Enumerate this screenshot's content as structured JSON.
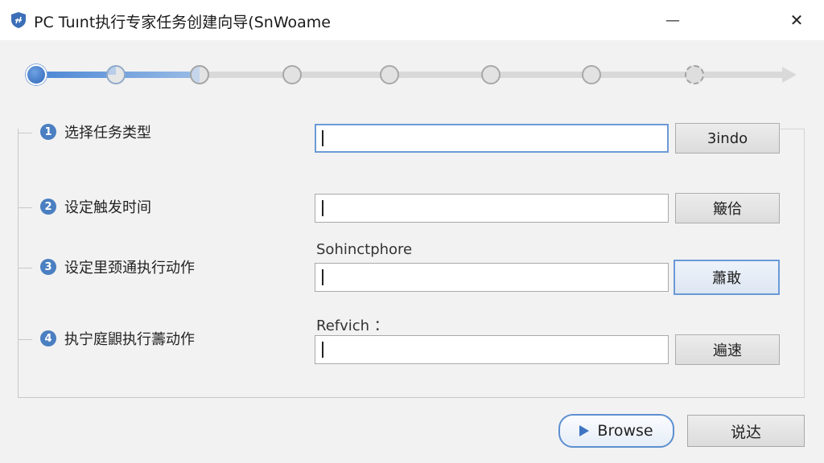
{
  "window": {
    "title": "PC Tuınt执行专家任务创建向导(SnWoame",
    "minimize_glyph": "—",
    "close_glyph": "✕",
    "icon": "app-shield-icon"
  },
  "stepper": {
    "total_steps": 8,
    "current_step": 1,
    "accent_color": "#3f7ad0"
  },
  "steps": [
    {
      "number": "1",
      "label": "选择任务类型",
      "caption": "",
      "button": "3indo",
      "input_value": ""
    },
    {
      "number": "2",
      "label": "设定触发时间",
      "caption": "",
      "button": "簸佮",
      "input_value": ""
    },
    {
      "number": "3",
      "label": "设定里颈通执行动作",
      "caption": "Sohinctphore",
      "button": "蕭敢",
      "input_value": ""
    },
    {
      "number": "4",
      "label": "执宁庭鼰执行薵动作",
      "caption": "Refvich ：",
      "button": "遍速",
      "input_value": ""
    }
  ],
  "footer": {
    "browse_label": "Browse",
    "cancel_label": "说达"
  }
}
